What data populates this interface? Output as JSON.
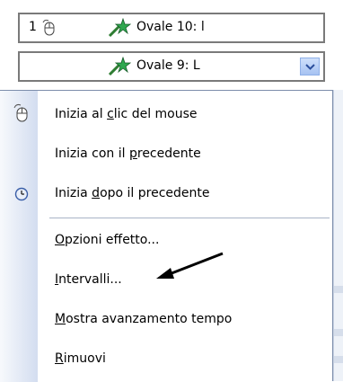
{
  "animation_list": {
    "rows": [
      {
        "order": "1",
        "label": "Ovale 10: l"
      },
      {
        "order": "",
        "label": "Ovale 9: L"
      }
    ]
  },
  "context_menu": {
    "items": [
      {
        "pre": "Inizia al ",
        "ul": "c",
        "post": "lic del mouse"
      },
      {
        "pre": "Inizia con il ",
        "ul": "p",
        "post": "recedente"
      },
      {
        "pre": "Inizia ",
        "ul": "d",
        "post": "opo il precedente"
      },
      {
        "pre": "",
        "ul": "O",
        "post": "pzioni effetto..."
      },
      {
        "pre": "",
        "ul": "I",
        "post": "ntervalli..."
      },
      {
        "pre": "",
        "ul": "M",
        "post": "ostra avanzamento tempo"
      },
      {
        "pre": "",
        "ul": "R",
        "post": "imuovi"
      }
    ]
  },
  "icons": {
    "mouse": "mouse-icon",
    "effect": "star-effect-icon",
    "clock": "clock-icon",
    "dropdown": "chevron-down-icon",
    "annotation": "arrow-icon"
  },
  "colors": {
    "accent": "#316ac5",
    "border": "#7a7a7a",
    "gutter": "#d3ddf0"
  }
}
